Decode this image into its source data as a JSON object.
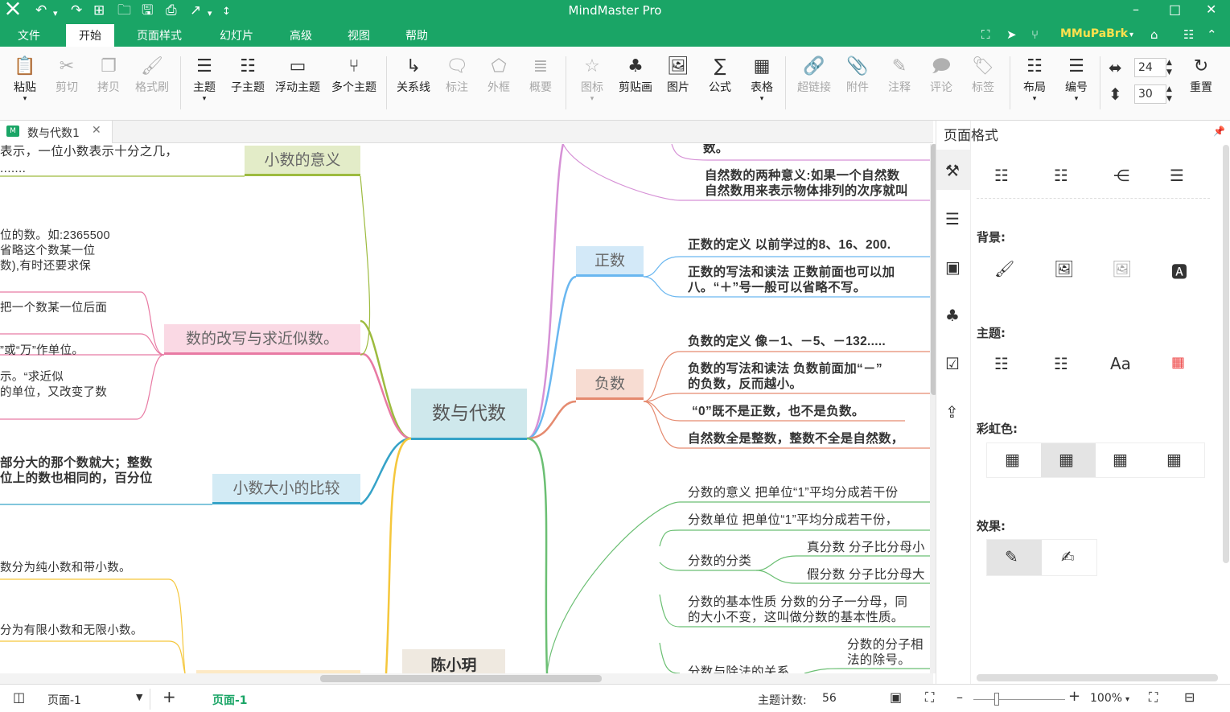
{
  "app": {
    "title": "MindMaster Pro",
    "user": "MMuPaBrk"
  },
  "menu": [
    "文件",
    "开始",
    "页面样式",
    "幻灯片",
    "高级",
    "视图",
    "帮助"
  ],
  "ribbon": {
    "paste": "粘贴",
    "cut": "剪切",
    "copy": "拷贝",
    "format_painter": "格式刷",
    "topic": "主题",
    "subtopic": "子主题",
    "floating": "浮动主题",
    "multiple": "多个主题",
    "relation": "关系线",
    "callout": "标注",
    "boundary": "外框",
    "summary": "概要",
    "icon": "图标",
    "clipart": "剪贴画",
    "picture": "图片",
    "formula": "公式",
    "table": "表格",
    "hyperlink": "超链接",
    "attachment": "附件",
    "note": "注释",
    "comment": "评论",
    "tag": "标签",
    "layout": "布局",
    "numbering": "编号",
    "spacing_h": "24",
    "spacing_v": "30",
    "reset": "重置"
  },
  "doc_tab": "数与代数1",
  "panel": {
    "title": "页面格式",
    "background": "背景:",
    "theme": "主题:",
    "rainbow": "彩虹色:",
    "effect": "效果:"
  },
  "map": {
    "center": "数与代数",
    "left_nodes": [
      "小数的意义",
      "数的改写与求近似数。",
      "小数大小的比较"
    ],
    "left_texts": [
      "表示，一位小数表示十分之几，",
      ".......",
      "位的数。如:2365500",
      "  省略这个数某一位",
      "数),有时还要求保",
      "把一个数某一位后面",
      "”或“万”作单位。",
      "示。“求近似",
      "的单位，又改变了数",
      "部分大的那个数就大；整数",
      "位上的数也相同的，百分位",
      "数分为纯小数和带小数。",
      "分为有限小数和无限小数。"
    ],
    "floating": "陈小玥",
    "right_nodes": [
      "正数",
      "负数"
    ],
    "right_texts": {
      "top1": "数。",
      "top2a": "自然数的两种意义:如果一个自然数",
      "top2b": "自然数用来表示物体排列的次序就叫",
      "pos1": "正数的定义  以前学过的8、16、200.",
      "pos2a": "正数的写法和读法  正数前面也可以加",
      "pos2b": "八。“＋”号一般可以省略不写。",
      "neg1": "负数的定义  像－1、－5、－132.....",
      "neg2a": "负数的写法和读法  负数前面加“－”",
      "neg2b": "的负数，反而越小。",
      "neg3": "“0”既不是正数，也不是负数。",
      "neg4": "自然数全是整数，整数不全是自然数，",
      "f1": "分数的意义  把单位“1”平均分成若干份",
      "f2": "分数单位  把单位“1”平均分成若干份，",
      "f3": "分数的分类",
      "f3a": "真分数  分子比分母小",
      "f3b": "假分数  分子比分母大",
      "f4a": "分数的基本性质  分数的分子一分母，同",
      "f4b": "的大小不变，这叫做分数的基本性质。",
      "f5": "分数与除法的关系",
      "f5a": "分数的分子相",
      "f5b": "法的除号。"
    }
  },
  "status": {
    "page_select": "页面-1",
    "page_tab": "页面-1",
    "topic_count_label": "主题计数:",
    "topic_count": "56",
    "zoom": "100%"
  }
}
